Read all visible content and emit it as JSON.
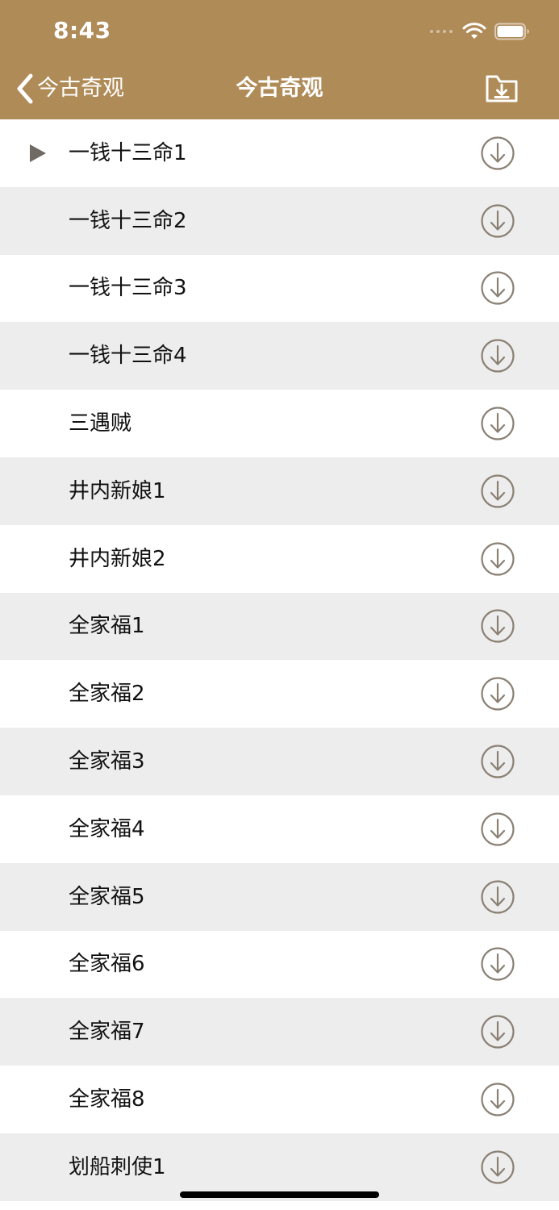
{
  "status_bar": {
    "time": "8:43"
  },
  "nav": {
    "back_label": "今古奇观",
    "title": "今古奇观",
    "back_icon": "chevron-left-icon",
    "right_icon": "download-folder-icon"
  },
  "colors": {
    "header_bg": "#af8b57",
    "row_alt_bg": "#ededed",
    "icon_gray": "#8a8074",
    "play_gray": "#6f6a63"
  },
  "list": {
    "now_playing_index": 0,
    "items": [
      {
        "title": "一钱十三命1"
      },
      {
        "title": "一钱十三命2"
      },
      {
        "title": "一钱十三命3"
      },
      {
        "title": "一钱十三命4"
      },
      {
        "title": "三遇贼"
      },
      {
        "title": "井内新娘1"
      },
      {
        "title": "井内新娘2"
      },
      {
        "title": "全家福1"
      },
      {
        "title": "全家福2"
      },
      {
        "title": "全家福3"
      },
      {
        "title": "全家福4"
      },
      {
        "title": "全家福5"
      },
      {
        "title": "全家福6"
      },
      {
        "title": "全家福7"
      },
      {
        "title": "全家福8"
      },
      {
        "title": "划船刺使1"
      }
    ]
  }
}
